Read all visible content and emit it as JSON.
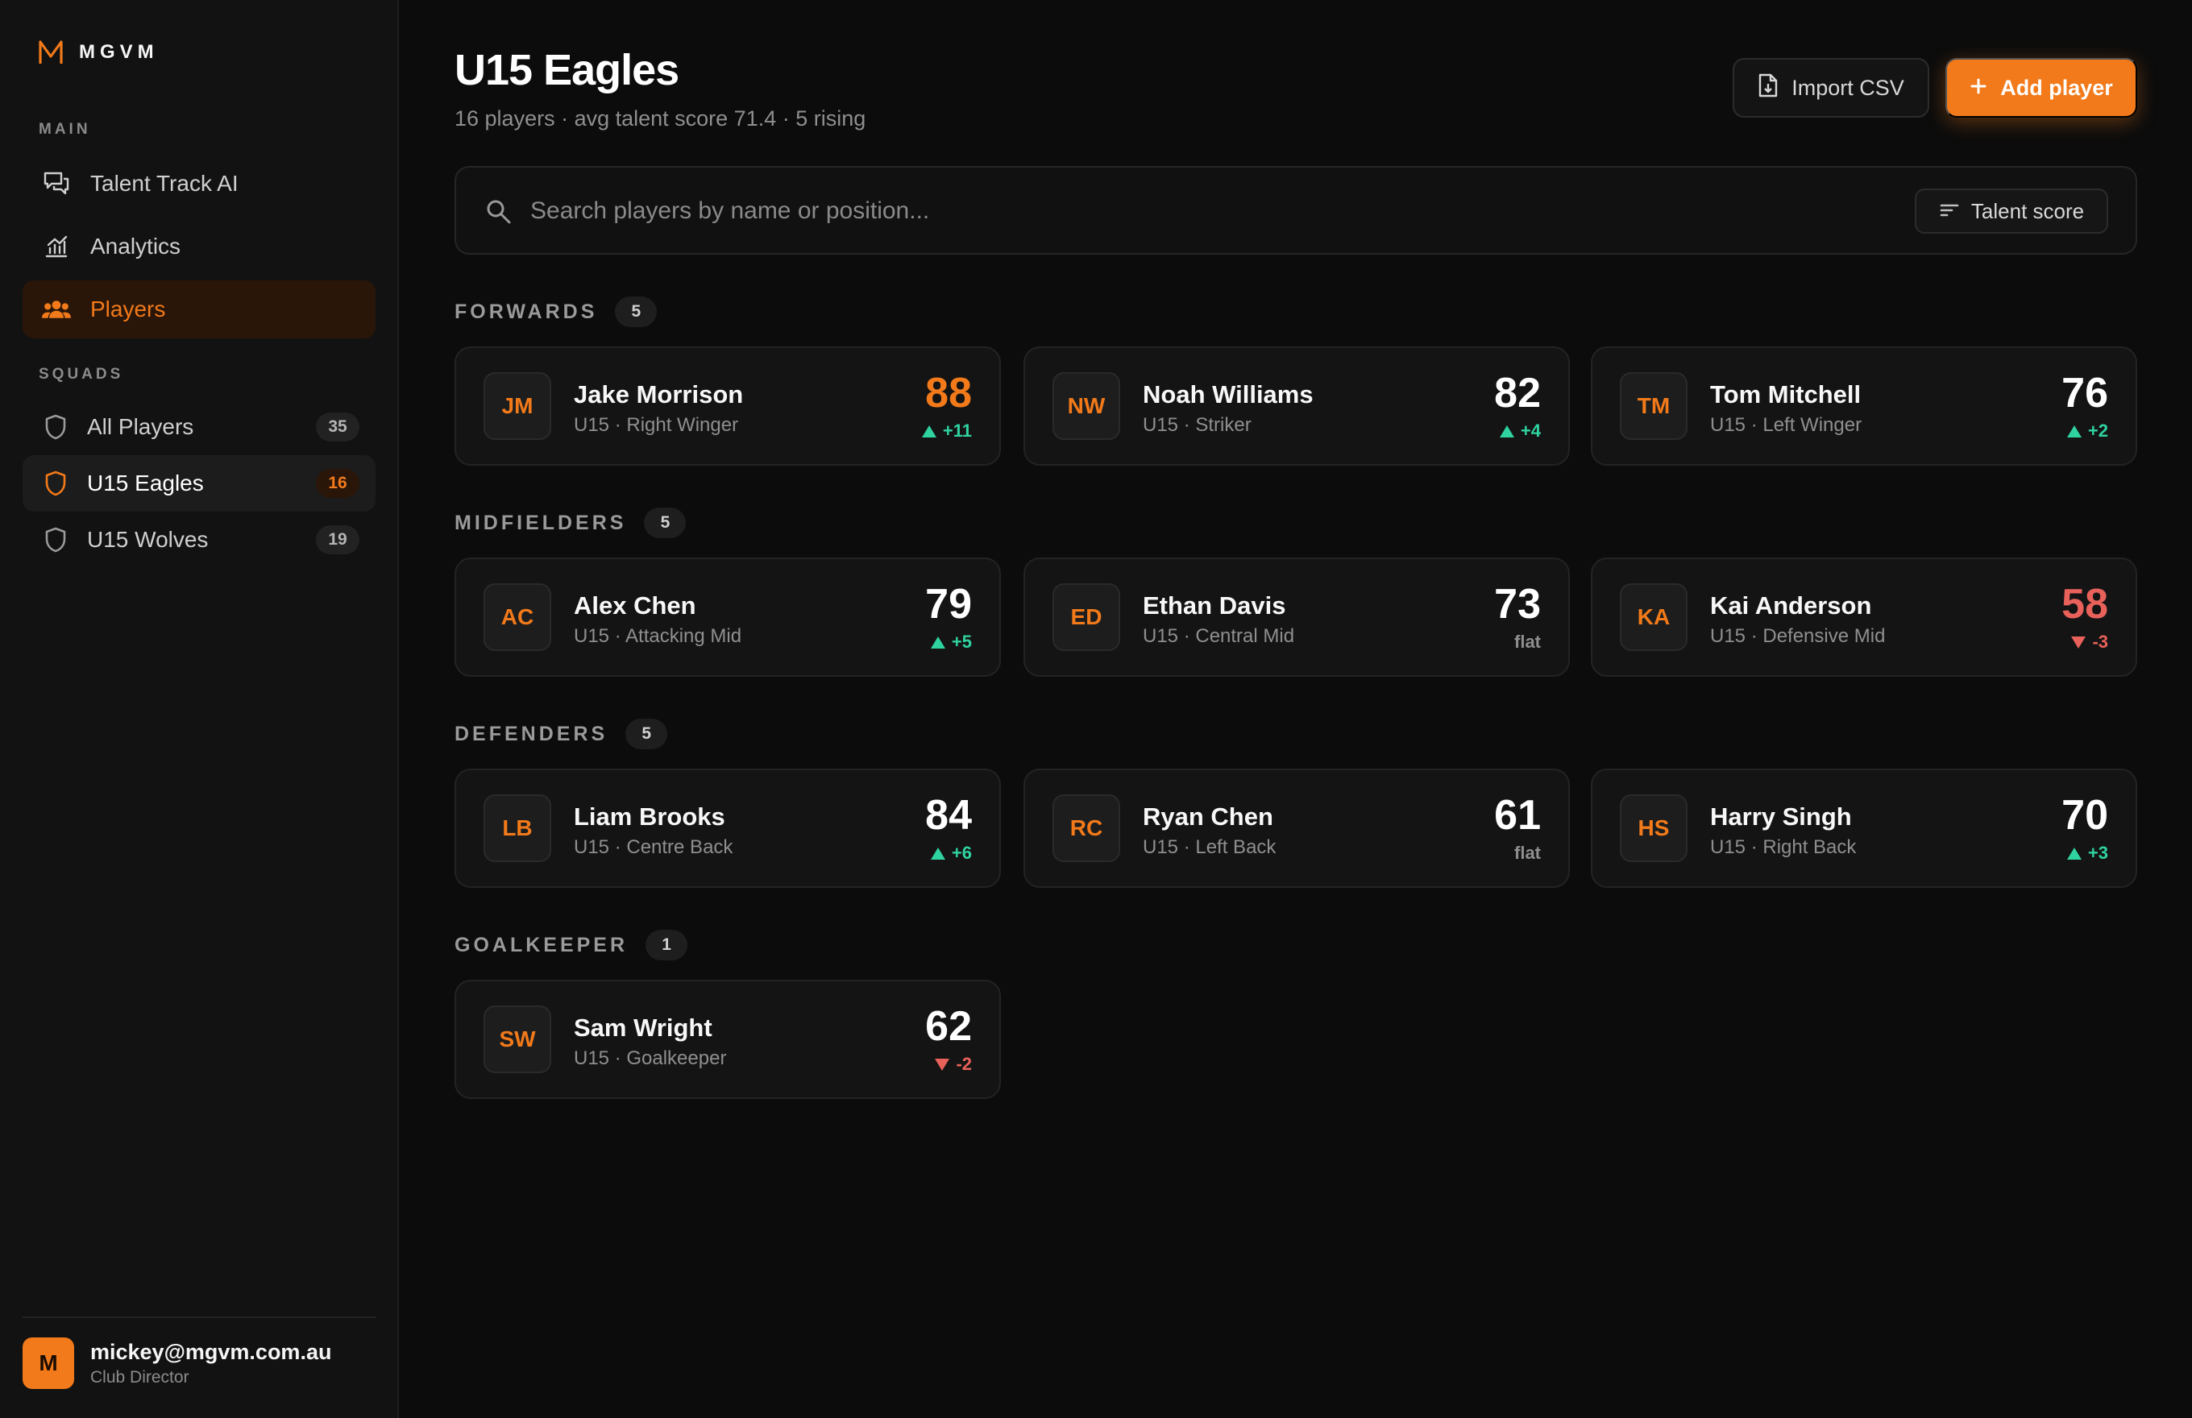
{
  "brand": {
    "name": "MGVM",
    "accent": "#f27a1a"
  },
  "sidebar": {
    "main_label": "MAIN",
    "nav": [
      {
        "label": "Talent Track AI",
        "icon": "chat-icon"
      },
      {
        "label": "Analytics",
        "icon": "chart-icon"
      },
      {
        "label": "Players",
        "icon": "users-icon",
        "active": true
      }
    ],
    "squads_label": "SQUADS",
    "squads": [
      {
        "label": "All Players",
        "count": "35",
        "icon": "shield-icon"
      },
      {
        "label": "U15 Eagles",
        "count": "16",
        "icon": "shield-icon",
        "active": true
      },
      {
        "label": "U15 Wolves",
        "count": "19",
        "icon": "shield-icon"
      }
    ],
    "user": {
      "initial": "M",
      "email": "mickey@mgvm.com.au",
      "role": "Club Director"
    }
  },
  "header": {
    "title": "U15 Eagles",
    "subtitle": "16 players · avg talent score 71.4 · 5 rising",
    "import_label": "Import CSV",
    "add_label": "Add player"
  },
  "search": {
    "placeholder": "Search players by name or position...",
    "sort_label": "Talent score"
  },
  "groups": [
    {
      "label": "FORWARDS",
      "count": "5",
      "players": [
        {
          "initials": "JM",
          "name": "Jake Morrison",
          "role": "U15 · Right Winger",
          "score": "88",
          "delta": "+11",
          "trend": "up"
        },
        {
          "initials": "NW",
          "name": "Noah Williams",
          "role": "U15 · Striker",
          "score": "82",
          "delta": "+4",
          "trend": "up"
        },
        {
          "initials": "TM",
          "name": "Tom Mitchell",
          "role": "U15 · Left Winger",
          "score": "76",
          "delta": "+2",
          "trend": "up"
        }
      ]
    },
    {
      "label": "MIDFIELDERS",
      "count": "5",
      "players": [
        {
          "initials": "AC",
          "name": "Alex Chen",
          "role": "U15 · Attacking Mid",
          "score": "79",
          "delta": "+5",
          "trend": "up"
        },
        {
          "initials": "ED",
          "name": "Ethan Davis",
          "role": "U15 · Central Mid",
          "score": "73",
          "delta": "flat",
          "trend": "flat"
        },
        {
          "initials": "KA",
          "name": "Kai Anderson",
          "role": "U15 · Defensive Mid",
          "score": "58",
          "delta": "-3",
          "trend": "down"
        }
      ]
    },
    {
      "label": "DEFENDERS",
      "count": "5",
      "players": [
        {
          "initials": "LB",
          "name": "Liam Brooks",
          "role": "U15 · Centre Back",
          "score": "84",
          "delta": "+6",
          "trend": "up"
        },
        {
          "initials": "RC",
          "name": "Ryan Chen",
          "role": "U15 · Left Back",
          "score": "61",
          "delta": "flat",
          "trend": "flat"
        },
        {
          "initials": "HS",
          "name": "Harry Singh",
          "role": "U15 · Right Back",
          "score": "70",
          "delta": "+3",
          "trend": "up"
        }
      ]
    },
    {
      "label": "GOALKEEPER",
      "count": "1",
      "players": [
        {
          "initials": "SW",
          "name": "Sam Wright",
          "role": "U15 · Goalkeeper",
          "score": "62",
          "delta": "-2",
          "trend": "down"
        }
      ]
    }
  ]
}
